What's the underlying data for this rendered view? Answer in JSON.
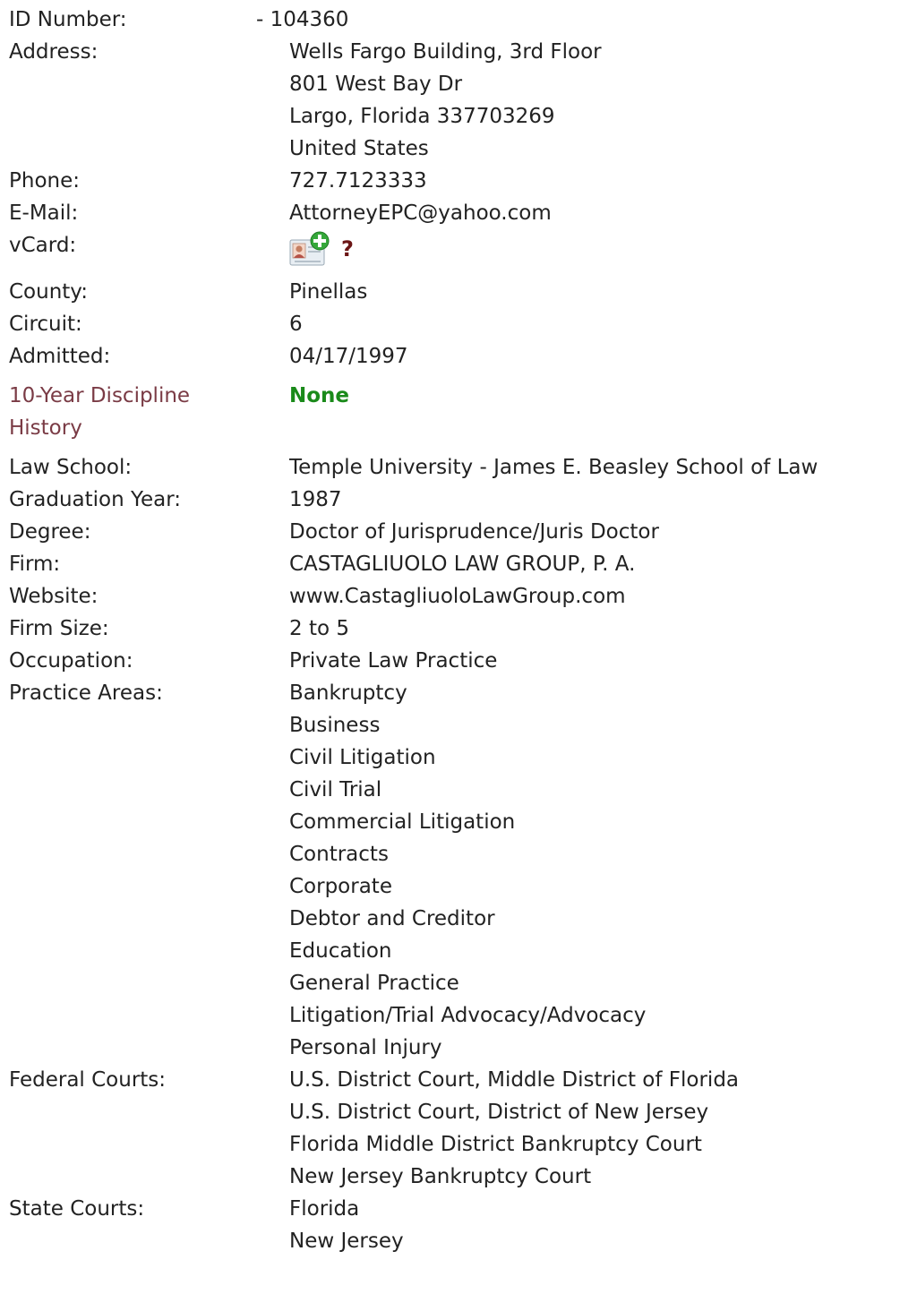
{
  "id": {
    "label": "ID Number:",
    "value": "- 104360"
  },
  "address": {
    "label": "Address:",
    "lines": [
      "Wells Fargo Building, 3rd Floor",
      "801 West Bay Dr",
      "Largo, Florida 337703269",
      "United States"
    ]
  },
  "phone": {
    "label": "Phone:",
    "value": "727.7123333"
  },
  "email": {
    "label": "E-Mail:",
    "value": "AttorneyEPC@yahoo.com"
  },
  "vcard": {
    "label": "vCard:",
    "icon": "vcard-add-icon",
    "help": "?"
  },
  "county": {
    "label": "County:",
    "value": "Pinellas"
  },
  "circuit": {
    "label": "Circuit:",
    "value": "6"
  },
  "admitted": {
    "label": "Admitted:",
    "value": "04/17/1997"
  },
  "discipline": {
    "label_line1": "10-Year Discipline",
    "label_line2": "History",
    "value": "None"
  },
  "law_school": {
    "label": "Law School:",
    "value": "Temple University - James E. Beasley School of Law"
  },
  "graduation": {
    "label": "Graduation Year:",
    "value": "1987"
  },
  "degree": {
    "label": "Degree:",
    "value": "Doctor of Jurisprudence/Juris Doctor"
  },
  "firm": {
    "label": "Firm:",
    "value": "CASTAGLIUOLO LAW GROUP, P. A."
  },
  "website": {
    "label": "Website:",
    "value": "www.CastagliuoloLawGroup.com"
  },
  "firm_size": {
    "label": "Firm Size:",
    "value": "2 to 5"
  },
  "occupation": {
    "label": "Occupation:",
    "value": "Private Law Practice"
  },
  "practice_areas": {
    "label": "Practice Areas:",
    "items": [
      "Bankruptcy",
      "Business",
      "Civil Litigation",
      "Civil Trial",
      "Commercial Litigation",
      "Contracts",
      "Corporate",
      "Debtor and Creditor",
      "Education",
      "General Practice",
      "Litigation/Trial Advocacy/Advocacy",
      "Personal Injury"
    ]
  },
  "federal_courts": {
    "label": "Federal Courts:",
    "items": [
      "U.S. District Court, Middle District of Florida",
      "U.S. District Court, District of New Jersey",
      "Florida Middle District Bankruptcy Court",
      "New Jersey Bankruptcy Court"
    ]
  },
  "state_courts": {
    "label": "State Courts:",
    "items": [
      "Florida",
      "New Jersey"
    ]
  },
  "colors": {
    "label_link": "#7a3b45",
    "none_green": "#1a8a1a",
    "help_red": "#6b1515"
  }
}
